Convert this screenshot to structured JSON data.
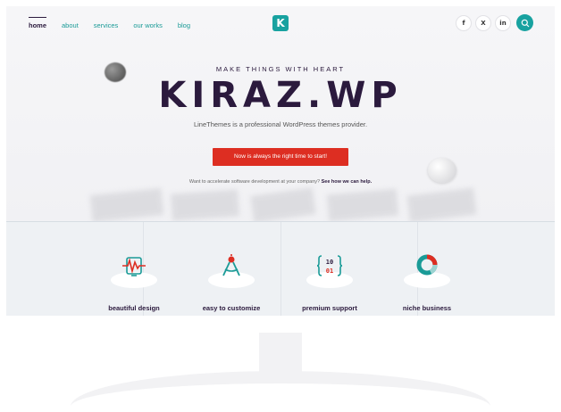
{
  "nav": {
    "items": [
      {
        "label": "home",
        "active": true
      },
      {
        "label": "about",
        "active": false
      },
      {
        "label": "services",
        "active": false
      },
      {
        "label": "our works",
        "active": false
      },
      {
        "label": "blog",
        "active": false
      }
    ]
  },
  "logo": {
    "glyph": "K",
    "color": "#18a2a0"
  },
  "social": {
    "facebook": "f",
    "x": "X",
    "linkedin": "in"
  },
  "hero": {
    "eyebrow": "MAKE THINGS WITH HEART",
    "title": "KIRAZ.WP",
    "tagline": "LineThemes is a professional WordPress themes provider.",
    "cta_label": "Now is always the right time to start!",
    "sub_text": "Want to accelerate software development at your company?",
    "sub_link": "See how we can help."
  },
  "features": [
    {
      "label": "beautiful design",
      "icon": "monitor-wave-icon"
    },
    {
      "label": "easy to customize",
      "icon": "compass-icon"
    },
    {
      "label": "premium support",
      "icon": "binary-braces-icon"
    },
    {
      "label": "niche business",
      "icon": "donut-chart-icon"
    }
  ],
  "colors": {
    "accent": "#18a2a0",
    "brand_dark": "#2b1a3d",
    "cta": "#dd2e22"
  }
}
